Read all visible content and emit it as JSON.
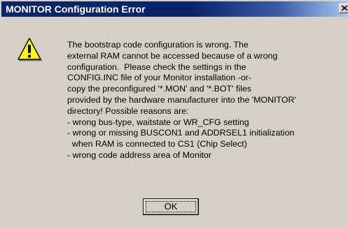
{
  "window": {
    "title": "MONITOR Configuration Error",
    "close_icon": "close-icon"
  },
  "dialog": {
    "icon": "warning-icon",
    "message_lines": [
      "The bootstrap code configuration is wrong. The",
      "external RAM cannot be accessed because of a wrong",
      "configuration.  Please check the settings in the",
      "CONFIG.INC file of your Monitor installation -or-",
      "copy the preconfigured '*.MON' and '*.BOT' files",
      "provided by the hardware manufacturer into the 'MONITOR'",
      "directory! Possible reasons are:",
      "- wrong bus-type, waitstate or WR_CFG setting",
      "- wrong or missing BUSCON1 and ADDRSEL1 initialization",
      "  when RAM is connected to CS1 (Chip Select)",
      "- wrong code address area of Monitor"
    ],
    "ok_label": "OK"
  },
  "colors": {
    "titlebar": "#0a246a",
    "face": "#d4d0c8",
    "warning_yellow": "#ffff00"
  }
}
